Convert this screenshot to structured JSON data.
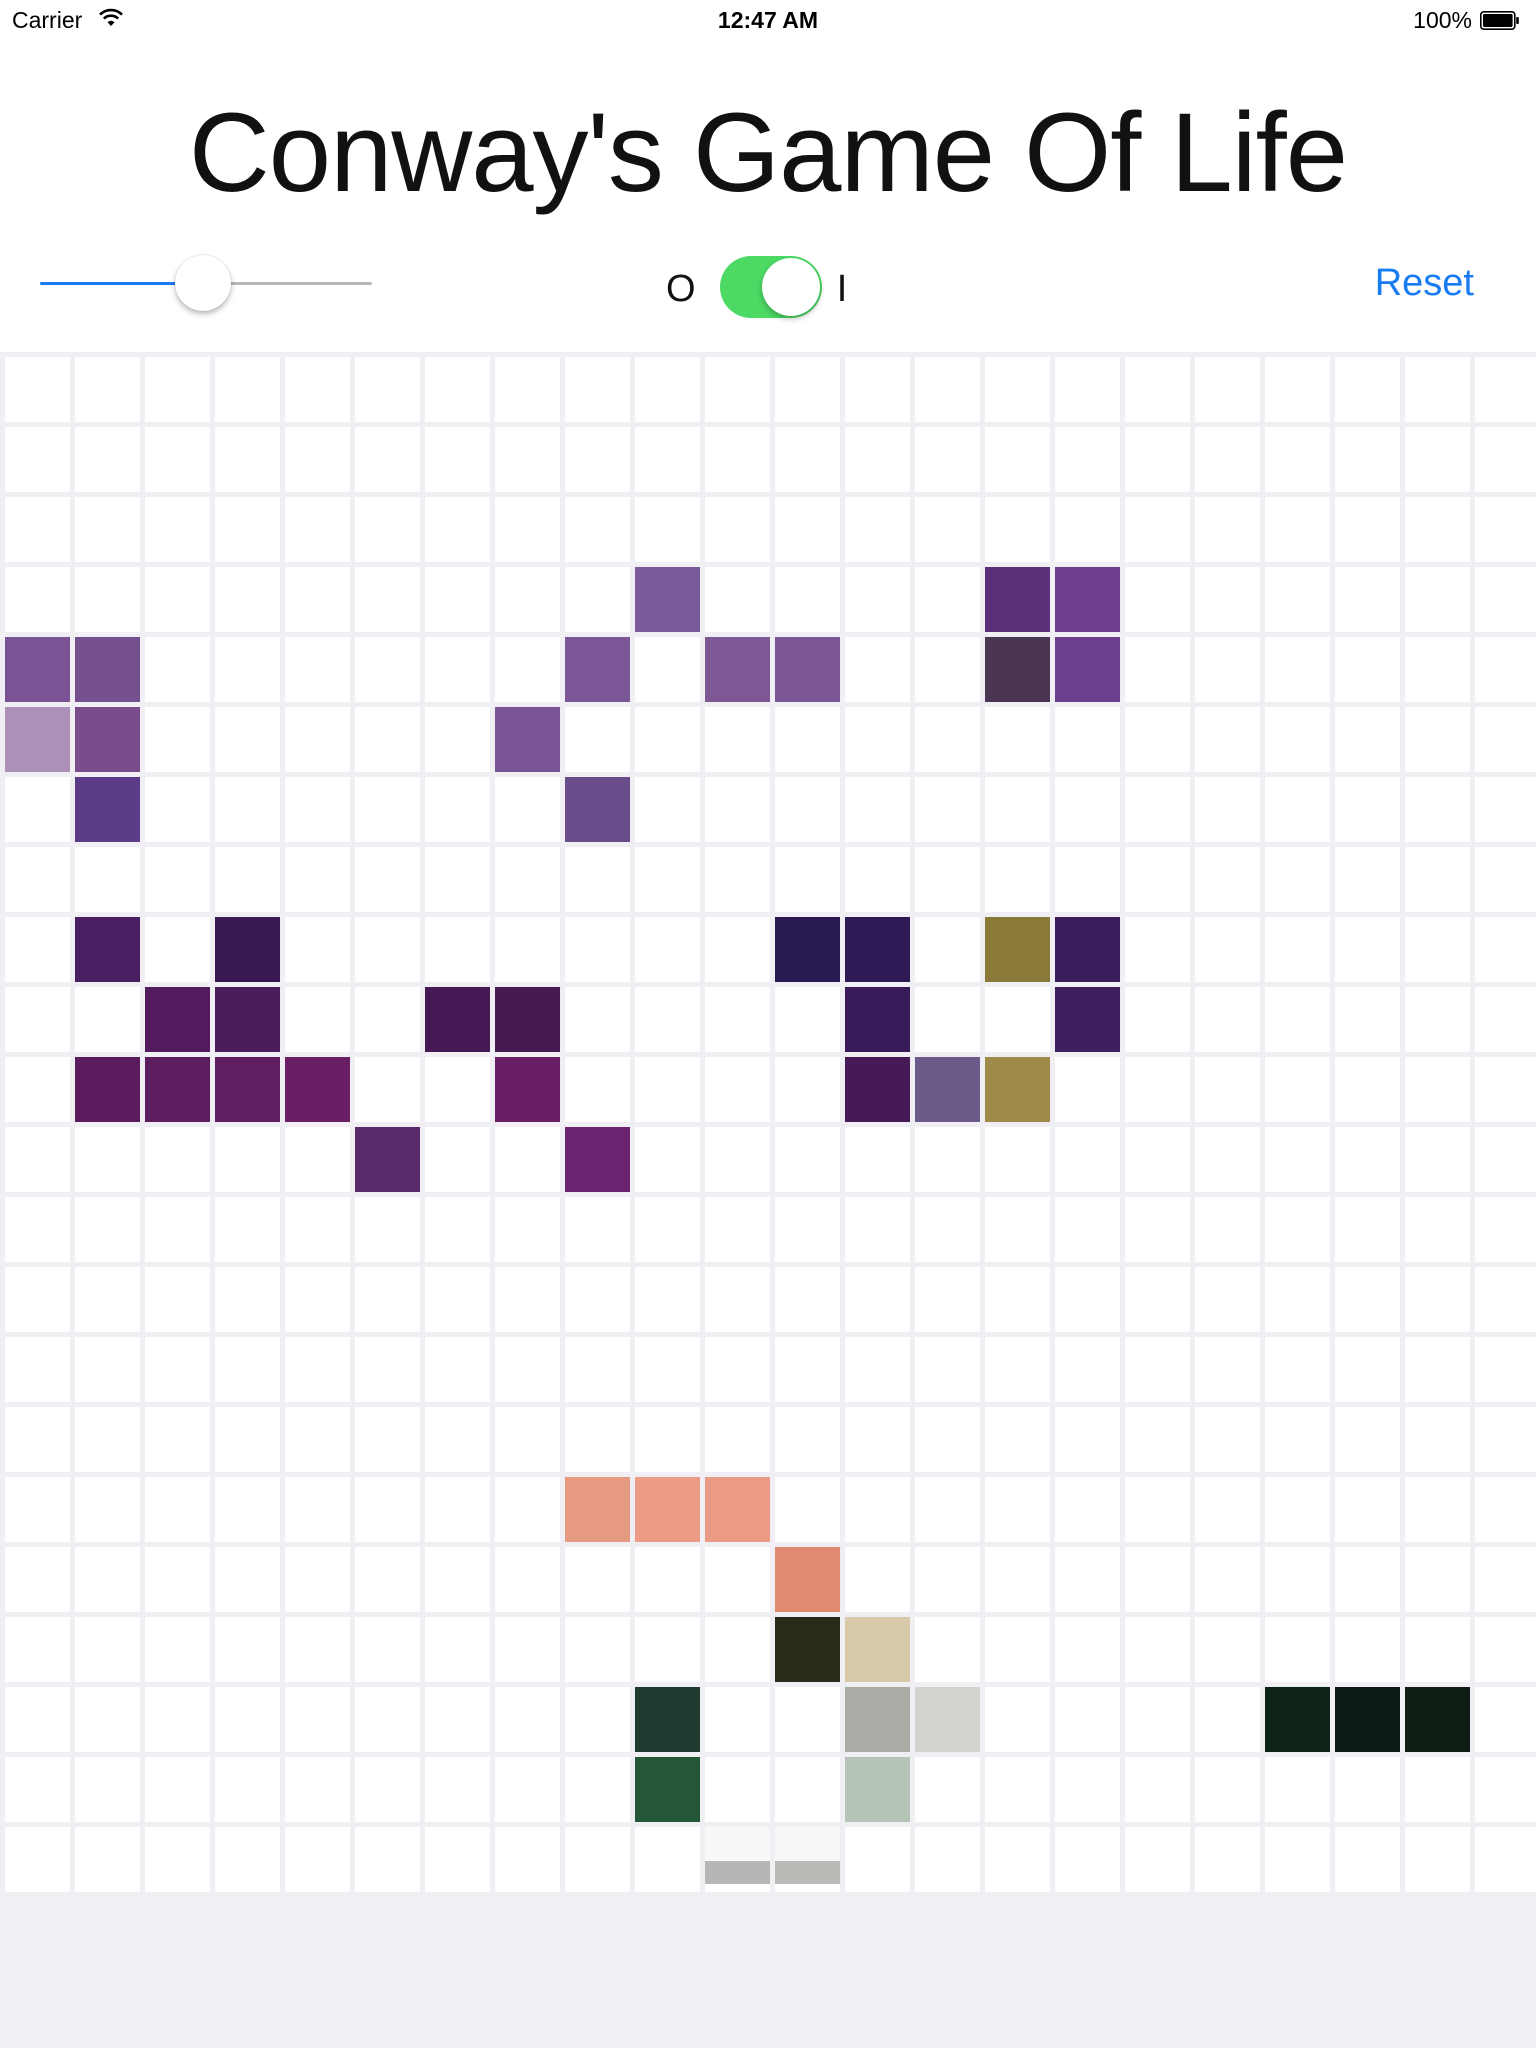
{
  "status_bar": {
    "carrier": "Carrier",
    "time": "12:47 AM",
    "battery": "100%"
  },
  "header": {
    "title": "Conway's Game Of Life"
  },
  "controls": {
    "speed_slider_value": 0.49,
    "toggle_off_label": "O",
    "toggle_on_label": "I",
    "toggle_on": true,
    "reset_label": "Reset"
  },
  "colors": {
    "accent": "#1a7cf2",
    "toggle_on": "#4cd964",
    "cell_empty": "#ffffff",
    "grid_background": "#efeff4"
  },
  "grid": {
    "columns": 22,
    "rows": 22,
    "live_cells": [
      {
        "r": 3,
        "c": 9,
        "color": "#7a5a98"
      },
      {
        "r": 3,
        "c": 14,
        "color": "#5b2f7a"
      },
      {
        "r": 3,
        "c": 15,
        "color": "#6d3f8d"
      },
      {
        "r": 4,
        "c": 0,
        "color": "#7a5296"
      },
      {
        "r": 4,
        "c": 1,
        "color": "#75508f"
      },
      {
        "r": 4,
        "c": 8,
        "color": "#7b5697"
      },
      {
        "r": 4,
        "c": 10,
        "color": "#7d5894"
      },
      {
        "r": 4,
        "c": 11,
        "color": "#7b5694"
      },
      {
        "r": 4,
        "c": 14,
        "color": "#4a3552"
      },
      {
        "r": 4,
        "c": 15,
        "color": "#6c3f8c"
      },
      {
        "r": 5,
        "c": 0,
        "color": "#ad90b8"
      },
      {
        "r": 5,
        "c": 1,
        "color": "#7b4c8c"
      },
      {
        "r": 5,
        "c": 7,
        "color": "#7a5596"
      },
      {
        "r": 6,
        "c": 1,
        "color": "#5c3c86"
      },
      {
        "r": 6,
        "c": 8,
        "color": "#694c8a"
      },
      {
        "r": 8,
        "c": 1,
        "color": "#4a1f62"
      },
      {
        "r": 8,
        "c": 3,
        "color": "#3a1952"
      },
      {
        "r": 8,
        "c": 11,
        "color": "#2a1a52"
      },
      {
        "r": 8,
        "c": 12,
        "color": "#2e1b55"
      },
      {
        "r": 8,
        "c": 14,
        "color": "#8a7a3a"
      },
      {
        "r": 8,
        "c": 15,
        "color": "#3a1d5c"
      },
      {
        "r": 9,
        "c": 2,
        "color": "#521c5e"
      },
      {
        "r": 9,
        "c": 3,
        "color": "#4d1c5a"
      },
      {
        "r": 9,
        "c": 6,
        "color": "#461955"
      },
      {
        "r": 9,
        "c": 7,
        "color": "#461a53"
      },
      {
        "r": 9,
        "c": 12,
        "color": "#3a1b5a"
      },
      {
        "r": 9,
        "c": 15,
        "color": "#3f1f5f"
      },
      {
        "r": 10,
        "c": 1,
        "color": "#5a1c5c"
      },
      {
        "r": 10,
        "c": 2,
        "color": "#5c1d5f"
      },
      {
        "r": 10,
        "c": 3,
        "color": "#5e1e60"
      },
      {
        "r": 10,
        "c": 4,
        "color": "#6a1f65"
      },
      {
        "r": 10,
        "c": 7,
        "color": "#6a1e66"
      },
      {
        "r": 10,
        "c": 12,
        "color": "#451a56"
      },
      {
        "r": 10,
        "c": 13,
        "color": "#6c5a8a"
      },
      {
        "r": 10,
        "c": 14,
        "color": "#a08a4a"
      },
      {
        "r": 11,
        "c": 5,
        "color": "#5a2a6a"
      },
      {
        "r": 11,
        "c": 8,
        "color": "#6d2470"
      },
      {
        "r": 16,
        "c": 8,
        "color": "#e69a82"
      },
      {
        "r": 16,
        "c": 9,
        "color": "#ec9c86"
      },
      {
        "r": 16,
        "c": 10,
        "color": "#ea9a85"
      },
      {
        "r": 17,
        "c": 11,
        "color": "#e08a70"
      },
      {
        "r": 18,
        "c": 11,
        "color": "#2a2a1a"
      },
      {
        "r": 18,
        "c": 12,
        "color": "#d8caa8"
      },
      {
        "r": 19,
        "c": 9,
        "color": "#1f3a2e"
      },
      {
        "r": 19,
        "c": 12,
        "color": "#a9aca5"
      },
      {
        "r": 19,
        "c": 13,
        "color": "#d3d3cf"
      },
      {
        "r": 19,
        "c": 18,
        "color": "#0f2418"
      },
      {
        "r": 19,
        "c": 19,
        "color": "#0d1a14"
      },
      {
        "r": 19,
        "c": 20,
        "color": "#0f1d15"
      },
      {
        "r": 20,
        "c": 9,
        "color": "#245638"
      },
      {
        "r": 20,
        "c": 12,
        "color": "#b5c4b7"
      },
      {
        "r": 21,
        "c": 10,
        "color": "#b4b7b3",
        "partial": true
      },
      {
        "r": 21,
        "c": 11,
        "color": "#b9bcb6",
        "partial": true
      }
    ]
  }
}
